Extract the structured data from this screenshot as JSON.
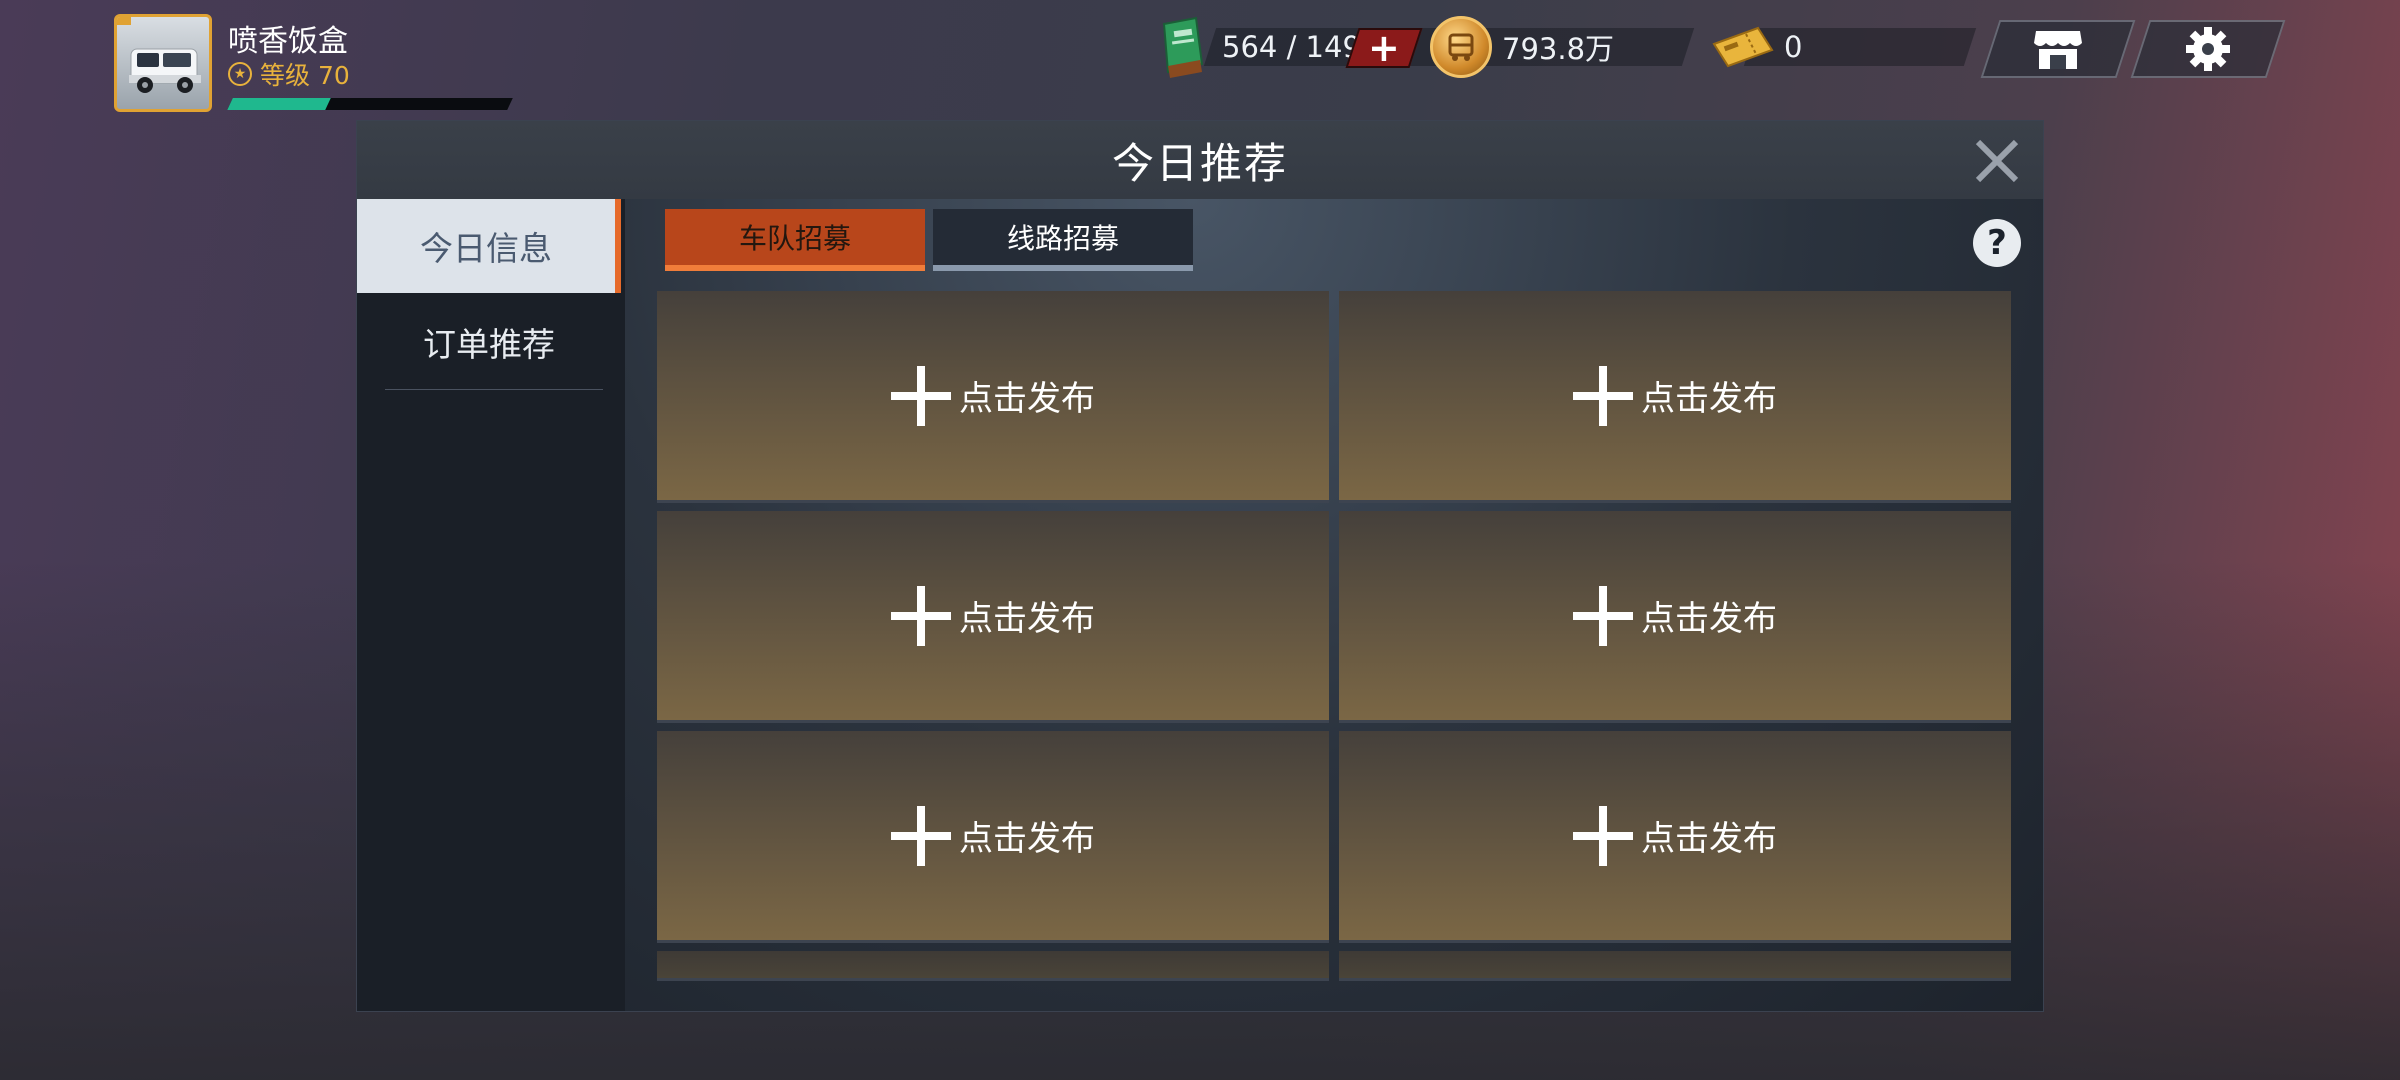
{
  "player": {
    "name": "喷香饭盒",
    "level_label": "等级 70",
    "xp_fraction": 0.35,
    "avatar": "white-minivan"
  },
  "currencies": {
    "fuel": {
      "icon": "fuel-can-icon",
      "value": "564 / 149",
      "add_label": "+"
    },
    "coins": {
      "icon": "coin-icon",
      "value": "793.8万"
    },
    "tickets": {
      "icon": "ticket-icon",
      "value": "0"
    }
  },
  "top_buttons": {
    "shop": "shop-icon",
    "settings": "gear-icon"
  },
  "dialog": {
    "title": "今日推荐",
    "close_label": "X",
    "sidebar": [
      {
        "label": "今日信息",
        "active": true
      },
      {
        "label": "订单推荐",
        "active": false
      }
    ],
    "tabs": [
      {
        "label": "车队招募",
        "active": true
      },
      {
        "label": "线路招募",
        "active": false
      }
    ],
    "help_label": "?",
    "slots": [
      {
        "label": "点击发布"
      },
      {
        "label": "点击发布"
      },
      {
        "label": "点击发布"
      },
      {
        "label": "点击发布"
      },
      {
        "label": "点击发布"
      },
      {
        "label": "点击发布"
      }
    ]
  },
  "colors": {
    "accent_orange": "#b8461b",
    "gold": "#e8b23c",
    "xp_green": "#1fb88e",
    "add_red": "#8b1a1a"
  }
}
